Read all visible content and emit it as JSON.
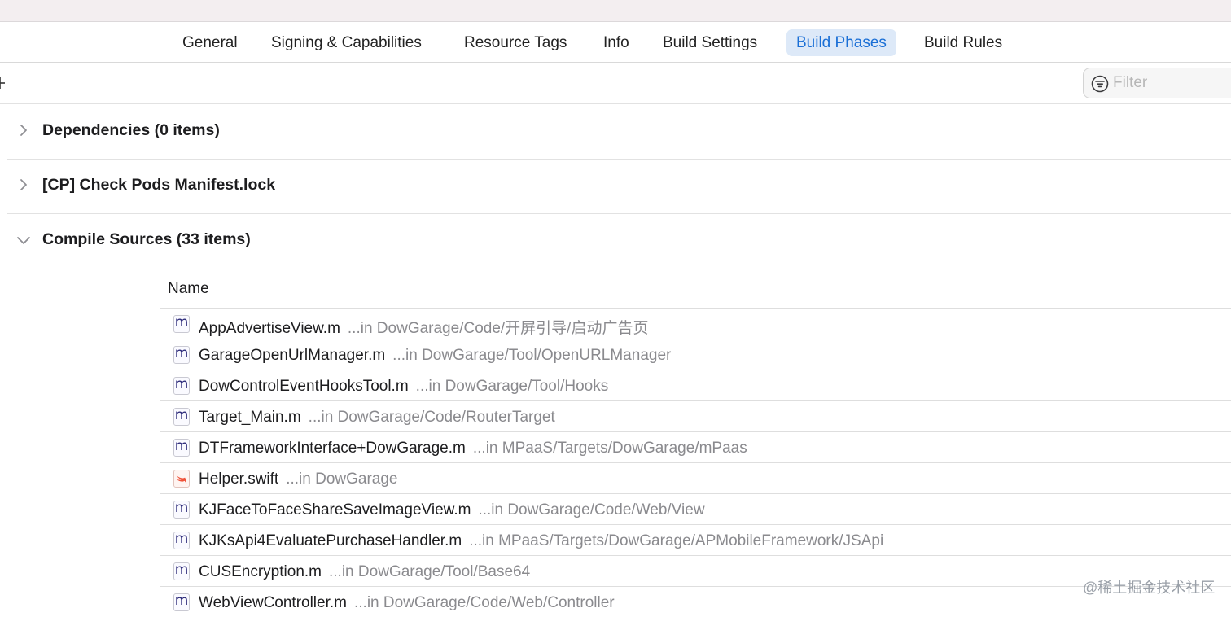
{
  "tabs": [
    {
      "label": "General",
      "active": false
    },
    {
      "label": "Signing & Capabilities",
      "active": false
    },
    {
      "label": "Resource Tags",
      "active": false
    },
    {
      "label": "Info",
      "active": false
    },
    {
      "label": "Build Settings",
      "active": false
    },
    {
      "label": "Build Phases",
      "active": true
    },
    {
      "label": "Build Rules",
      "active": false
    }
  ],
  "toolbar": {
    "filter_placeholder": "Filter"
  },
  "phases": [
    {
      "title": "Dependencies (0 items)",
      "expanded": false
    },
    {
      "title": "[CP] Check Pods Manifest.lock",
      "expanded": false
    },
    {
      "title": "Compile Sources (33 items)",
      "expanded": true
    }
  ],
  "compile_sources": {
    "column_header": "Name",
    "files": [
      {
        "name": "AppAdvertiseView.m",
        "path": "...in DowGarage/Code/开屏引导/启动广告页",
        "type": "m"
      },
      {
        "name": "GarageOpenUrlManager.m",
        "path": "...in DowGarage/Tool/OpenURLManager",
        "type": "m"
      },
      {
        "name": "DowControlEventHooksTool.m",
        "path": "...in DowGarage/Tool/Hooks",
        "type": "m"
      },
      {
        "name": "Target_Main.m",
        "path": "...in DowGarage/Code/RouterTarget",
        "type": "m"
      },
      {
        "name": "DTFrameworkInterface+DowGarage.m",
        "path": "...in MPaaS/Targets/DowGarage/mPaas",
        "type": "m"
      },
      {
        "name": "Helper.swift",
        "path": "...in DowGarage",
        "type": "swift"
      },
      {
        "name": "KJFaceToFaceShareSaveImageView.m",
        "path": "...in DowGarage/Code/Web/View",
        "type": "m"
      },
      {
        "name": "KJKsApi4EvaluatePurchaseHandler.m",
        "path": "...in MPaaS/Targets/DowGarage/APMobileFramework/JSApi",
        "type": "m"
      },
      {
        "name": "CUSEncryption.m",
        "path": "...in DowGarage/Tool/Base64",
        "type": "m"
      },
      {
        "name": "WebViewController.m",
        "path": "...in DowGarage/Code/Web/Controller",
        "type": "m"
      }
    ]
  },
  "watermark": "@稀土掘金技术社区",
  "colors": {
    "accent": "#1a6fd6",
    "active_tab_bg": "#dde9f8",
    "path_text": "#8a8a8e"
  }
}
